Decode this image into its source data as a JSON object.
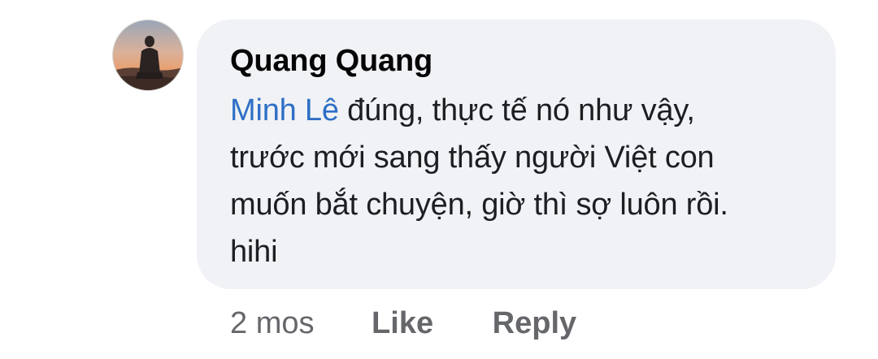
{
  "comment": {
    "author": "Quang Quang",
    "mention": "Minh Lê",
    "lines": [
      " đúng, thực tế nó như vậy,",
      "trước mới sang thấy người Việt con",
      "muốn bắt chuyện, giờ thì sợ luôn rồi.",
      "hihi"
    ],
    "avatar_icon": "profile-photo-person-sunset"
  },
  "actions": {
    "time": "2 mos",
    "like_label": "Like",
    "reply_label": "Reply"
  },
  "colors": {
    "bubble_bg": "#f0f2f5",
    "mention": "#2e6fc6",
    "secondary_text": "#65676b"
  }
}
